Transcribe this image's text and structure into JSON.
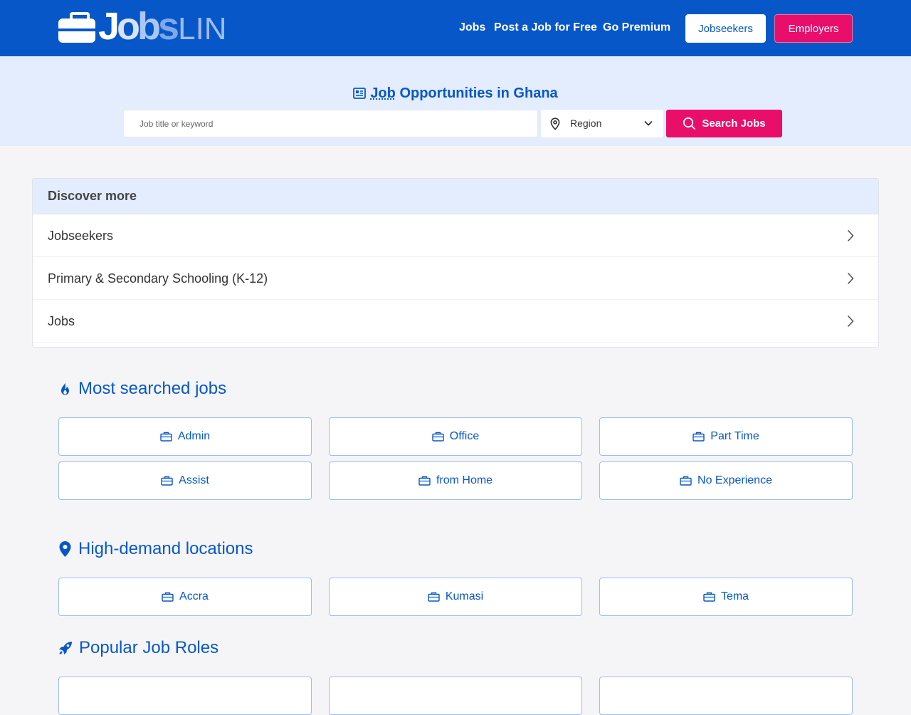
{
  "header": {
    "logo_parts": {
      "j": "J",
      "o": "o",
      "b": "b",
      "s": "s",
      "lin": "LIN"
    },
    "nav": [
      "Jobs",
      "Post a Job for Free",
      "Go Premium"
    ],
    "jobseekers_label": "Jobseekers",
    "employers_label": "Employers"
  },
  "hero": {
    "title_word": "Job",
    "title_rest": "Opportunities in Ghana",
    "search_placeholder": "Job title or keyword",
    "region_label": "Region",
    "search_button": "Search Jobs"
  },
  "discover": {
    "heading": "Discover more",
    "items": [
      "Jobseekers",
      "Primary & Secondary Schooling (K-12)",
      "Jobs"
    ]
  },
  "most_searched": {
    "title": "Most searched jobs",
    "items": [
      "Admin",
      "Office",
      "Part Time",
      "Assist",
      "from Home",
      "No Experience"
    ]
  },
  "locations": {
    "title": "High-demand locations",
    "items": [
      "Accra",
      "Kumasi",
      "Tema"
    ]
  },
  "roles": {
    "title": "Popular Job Roles"
  },
  "colors": {
    "primary": "#0757c9",
    "accent": "#ea0e6b",
    "hero_bg": "#e3edfd",
    "page_bg": "#f5f5f8"
  },
  "icons": {
    "logo": "briefcase-icon",
    "hero": "newspaper-icon",
    "region": "location-pin-icon",
    "search": "search-icon",
    "row_chevron": "chevron-right-icon",
    "most_searched": "flame-icon",
    "locations": "map-marker-icon",
    "roles": "rocket-icon",
    "tag": "briefcase-outline-icon"
  }
}
